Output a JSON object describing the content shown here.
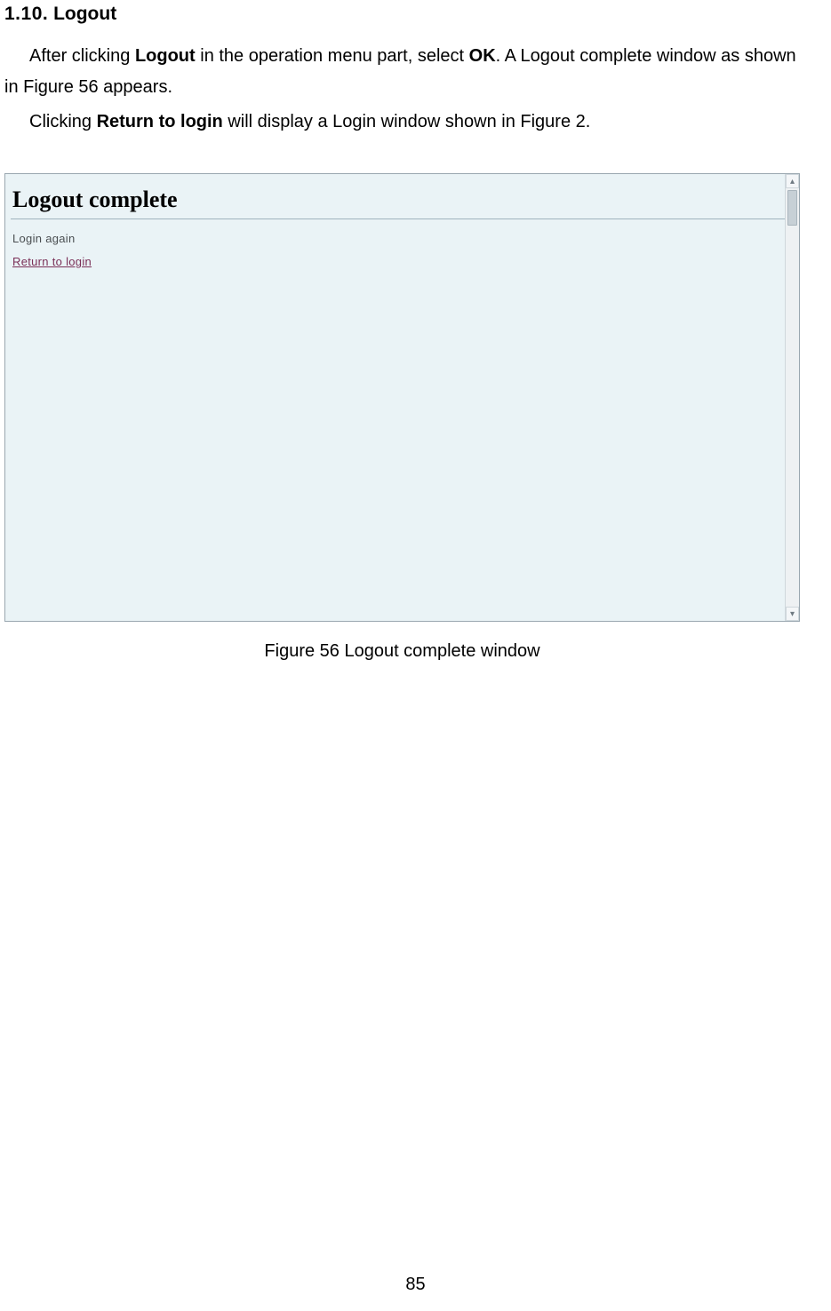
{
  "heading": {
    "number": "1.10.",
    "title": "Logout"
  },
  "paragraphs": {
    "p1_a": "After clicking ",
    "p1_b": "Logout",
    "p1_c": " in the operation menu part, select ",
    "p1_d": "OK",
    "p1_e": ". A Logout complete window as shown in Figure 56 appears.",
    "p2_a": "Clicking ",
    "p2_b": "Return to login",
    "p2_c": " will display a Login window shown in Figure 2."
  },
  "screenshot": {
    "title": "Logout complete",
    "login_again": "Login again",
    "return_link": "Return to login",
    "scroll_up": "▴",
    "scroll_down": "▾"
  },
  "caption": "Figure 56 Logout complete window",
  "page_number": "85"
}
